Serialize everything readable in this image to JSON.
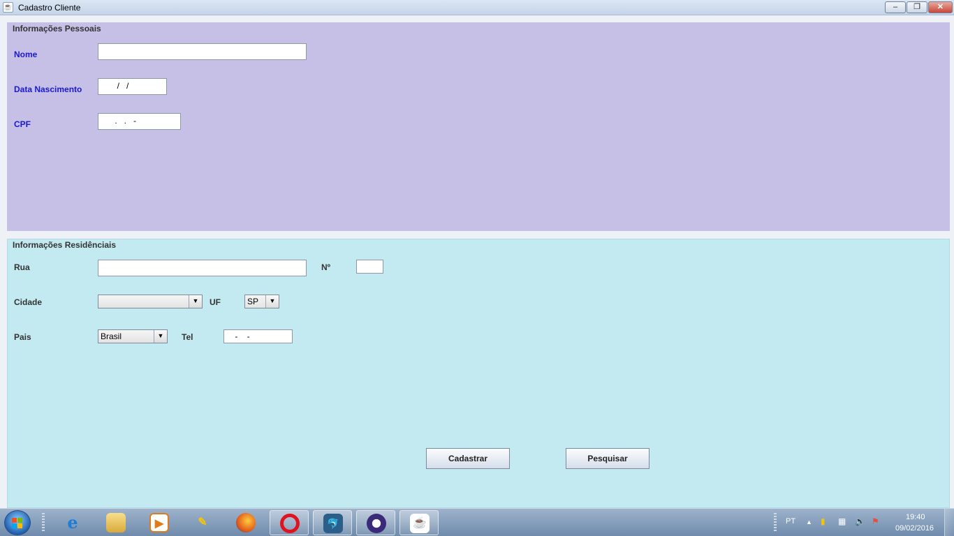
{
  "window": {
    "title": "Cadastro Cliente",
    "min_symbol": "–",
    "max_symbol": "❐",
    "close_symbol": "✕"
  },
  "personal": {
    "title": "Informações Pessoais",
    "nome_label": "Nome",
    "nome_value": "",
    "data_label": "Data Nascimento",
    "data_mask": "  /   /",
    "cpf_label": "CPF",
    "cpf_mask": " .   .   -"
  },
  "residential": {
    "title": "Informações Residênciais",
    "rua_label": "Rua",
    "rua_value": "",
    "numero_label": "Nº",
    "numero_value": "",
    "cidade_label": "Cidade",
    "cidade_value": "",
    "uf_label": "UF",
    "uf_value": "SP",
    "pais_label": "Pais",
    "pais_value": "Brasil",
    "tel_label": "Tel",
    "tel_mask": " -    -"
  },
  "buttons": {
    "cadastrar": "Cadastrar",
    "pesquisar": "Pesquisar"
  },
  "taskbar": {
    "icons": [
      "internet-explorer",
      "file-explorer",
      "media-player",
      "tools",
      "firefox",
      "opera",
      "mysql-workbench",
      "eclipse",
      "java"
    ],
    "tray_lang": "PT",
    "time": "19:40",
    "date": "09/02/2016"
  },
  "colors": {
    "personal_bg": "#c6bfe6",
    "residential_bg": "#c3e9f1",
    "label_blue": "#1a1ad0"
  }
}
